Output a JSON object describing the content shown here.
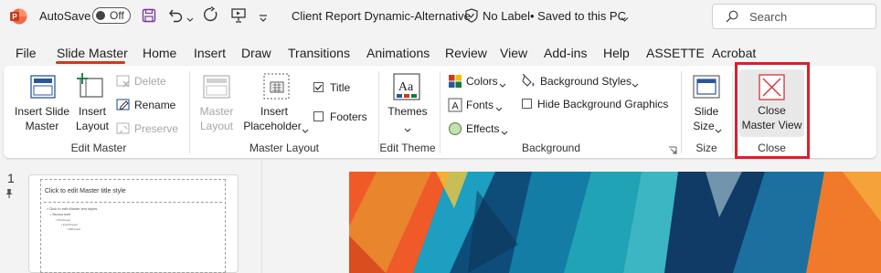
{
  "titlebar": {
    "autosave_label": "AutoSave",
    "autosave_state": "Off",
    "doc_title": "Client Report Dynamic-Alternative",
    "sensitivity": "No Label",
    "save_status": "• Saved to this PC",
    "search_placeholder": "Search"
  },
  "tabs": [
    "File",
    "Slide Master",
    "Home",
    "Insert",
    "Draw",
    "Transitions",
    "Animations",
    "Review",
    "View",
    "Add-ins",
    "Help",
    "ASSETTE",
    "Acrobat"
  ],
  "active_tab": "Slide Master",
  "ribbon": {
    "edit_master": {
      "label": "Edit Master",
      "insert_slide_master": [
        "Insert Slide",
        "Master"
      ],
      "insert_layout": [
        "Insert",
        "Layout"
      ],
      "delete": "Delete",
      "rename": "Rename",
      "preserve": "Preserve"
    },
    "master_layout": {
      "label": "Master Layout",
      "master_layout_btn": [
        "Master",
        "Layout"
      ],
      "insert_placeholder": [
        "Insert",
        "Placeholder"
      ],
      "title": "Title",
      "title_checked": true,
      "footers": "Footers",
      "footers_checked": false
    },
    "edit_theme": {
      "label": "Edit Theme",
      "themes": "Themes"
    },
    "background": {
      "label": "Background",
      "colors": "Colors",
      "fonts": "Fonts",
      "effects": "Effects",
      "background_styles": "Background Styles",
      "hide_background_graphics": "Hide Background Graphics",
      "hide_checked": false
    },
    "size": {
      "label": "Size",
      "slide_size": [
        "Slide",
        "Size"
      ]
    },
    "close": {
      "label": "Close",
      "close_master_view": [
        "Close",
        "Master View"
      ]
    }
  },
  "thumbnails": {
    "slide_number": "1",
    "master_title": "Click to edit Master title style",
    "master_text": "• Click to edit Master text styles",
    "levels": [
      "• Second level",
      "• Third level",
      "• Fourth level",
      "• Fifth level"
    ]
  },
  "colors": {
    "accent": "#c43e1c",
    "highlight": "#d9202b",
    "close_icon": "#d13438"
  }
}
